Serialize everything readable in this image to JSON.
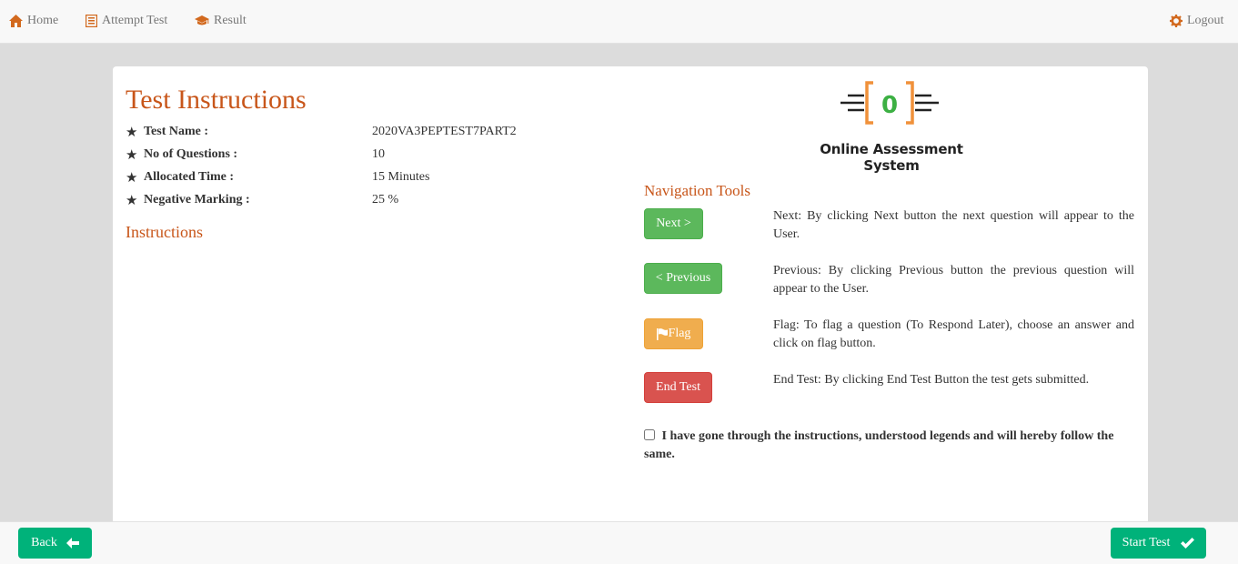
{
  "nav": {
    "home": "Home",
    "attempt_test": "Attempt Test",
    "result": "Result",
    "logout": "Logout",
    "icon_color": "#d2691e"
  },
  "page": {
    "title": "Test Instructions",
    "details": [
      {
        "label": "Test Name :",
        "value": "2020VA3PEPTEST7PART2"
      },
      {
        "label": "No of Questions :",
        "value": "10"
      },
      {
        "label": "Allocated Time :",
        "value": "15 Minutes"
      },
      {
        "label": "Negative Marking :",
        "value": "25 %"
      }
    ],
    "instructions_heading": "Instructions"
  },
  "logo": {
    "symbol": "0",
    "text": "Online Assessment System",
    "bracket_color": "#f0913a",
    "symbol_color": "#3cb043"
  },
  "navigation_tools": {
    "heading": "Navigation Tools",
    "items": [
      {
        "button": "Next >",
        "description": "Next: By clicking Next button the next question will appear to the User.",
        "color": "#5cb85c"
      },
      {
        "button": "< Previous",
        "description": "Previous: By clicking Previous button the previous question will appear to the User.",
        "color": "#5cb85c"
      },
      {
        "button": "Flag",
        "description": "Flag: To flag a question (To Respond Later), choose an answer and click on flag button.",
        "color": "#f0ad4e"
      },
      {
        "button": "End Test",
        "description": "End Test: By clicking End Test Button the test gets submitted.",
        "color": "#d9534f"
      }
    ]
  },
  "agreement": {
    "text": "I have gone through the instructions, understood legends and will hereby follow the same.",
    "checked": false
  },
  "footer": {
    "back": "Back",
    "start_test": "Start Test",
    "button_color": "#00b27a"
  }
}
